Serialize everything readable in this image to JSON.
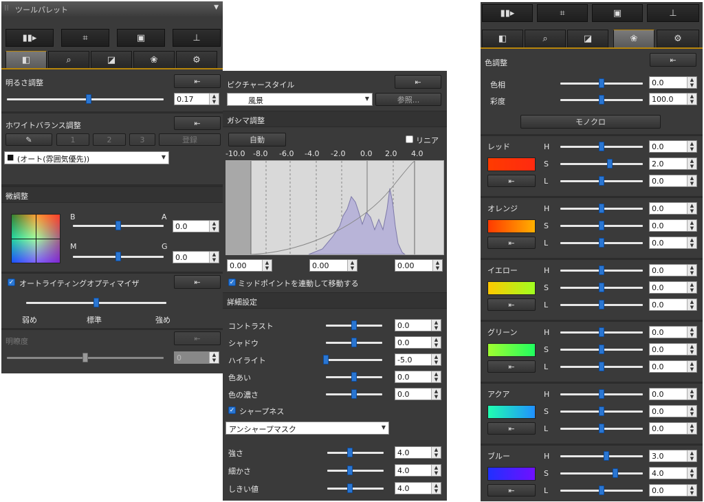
{
  "p1": {
    "title": "ツールパレット",
    "brightness": {
      "label": "明るさ調整",
      "value": "0.17",
      "level": 0.52
    },
    "wb": {
      "label": "ホワイトバランス調整",
      "btn1": "1",
      "btn2": "2",
      "btn3": "3",
      "register": "登録",
      "preset": "(オート(雰囲気優先))"
    },
    "fine": {
      "label": "微調整",
      "b": "B",
      "a": "A",
      "m": "M",
      "g": "G",
      "ba_value": "0.0",
      "mg_value": "0.0",
      "ba_level": 0.5,
      "mg_level": 0.5
    },
    "alo": {
      "label": "オートライティングオプティマイザ",
      "low": "弱め",
      "std": "標準",
      "high": "強め",
      "level": 0.5,
      "checked": true
    },
    "clarity": {
      "label": "明瞭度",
      "value": "0",
      "level": 0.5
    }
  },
  "p2": {
    "picture_style": {
      "label": "ピクチャースタイル",
      "value": "風景",
      "browse": "参照..."
    },
    "gamma": {
      "label": "ガンマ調整",
      "auto": "自動",
      "linear": "リニア",
      "ticks": [
        "-10.0",
        "-8.0",
        "-6.0",
        "-4.0",
        "-2.0",
        "0.0",
        "2.0",
        "4.0"
      ],
      "val1": "0.00",
      "val2": "0.00",
      "val3": "0.00",
      "midpoint": "ミッドポイントを連動して移動する"
    },
    "detail": {
      "label": "詳細設定",
      "rows": [
        {
          "label": "コントラスト",
          "value": "0.0",
          "level": 0.5
        },
        {
          "label": "シャドウ",
          "value": "0.0",
          "level": 0.5
        },
        {
          "label": "ハイライト",
          "value": "-5.0",
          "level": 0.0
        },
        {
          "label": "色あい",
          "value": "0.0",
          "level": 0.5
        },
        {
          "label": "色の濃さ",
          "value": "0.0",
          "level": 0.5
        }
      ]
    },
    "sharp": {
      "label": "シャープネス",
      "mode": "アンシャープマスク",
      "rows": [
        {
          "label": "強さ",
          "value": "4.0",
          "level": 0.4
        },
        {
          "label": "細かさ",
          "value": "4.0",
          "level": 0.4
        },
        {
          "label": "しきい値",
          "value": "4.0",
          "level": 0.4
        }
      ]
    }
  },
  "p3": {
    "label": "色調整",
    "hue": {
      "label": "色相",
      "value": "0.0",
      "level": 0.5
    },
    "sat": {
      "label": "彩度",
      "value": "100.0",
      "level": 0.5
    },
    "mono": "モノクロ",
    "colors": [
      {
        "name": "レッド",
        "h": "0.0",
        "s": "2.0",
        "l": "0.0",
        "hl": 0.5,
        "sl": 0.6,
        "ll": 0.5,
        "c1": "#ff3b00",
        "c2": "#ff2a10"
      },
      {
        "name": "オレンジ",
        "h": "0.0",
        "s": "0.0",
        "l": "0.0",
        "hl": 0.5,
        "sl": 0.5,
        "ll": 0.5,
        "c1": "#ff3a00",
        "c2": "#ffb000"
      },
      {
        "name": "イエロー",
        "h": "0.0",
        "s": "0.0",
        "l": "0.0",
        "hl": 0.5,
        "sl": 0.5,
        "ll": 0.5,
        "c1": "#ffc800",
        "c2": "#a0ff20"
      },
      {
        "name": "グリーン",
        "h": "0.0",
        "s": "0.0",
        "l": "0.0",
        "hl": 0.5,
        "sl": 0.5,
        "ll": 0.5,
        "c1": "#a0ff30",
        "c2": "#20ff60"
      },
      {
        "name": "アクア",
        "h": "0.0",
        "s": "0.0",
        "l": "0.0",
        "hl": 0.5,
        "sl": 0.5,
        "ll": 0.5,
        "c1": "#20ffb0",
        "c2": "#2090ff"
      },
      {
        "name": "ブルー",
        "h": "3.0",
        "s": "4.0",
        "l": "0.0",
        "hl": 0.56,
        "sl": 0.67,
        "ll": 0.5,
        "c1": "#2030ff",
        "c2": "#7010ff"
      }
    ],
    "h": "H",
    "s": "S",
    "l": "L"
  },
  "icons": [
    "compare-icon",
    "crop-icon",
    "image-icon",
    "stamp-icon",
    "brightness-tab-icon",
    "nr-tab-icon",
    "tone-tab-icon",
    "color-tab-icon",
    "settings-tab-icon",
    "reset-icon",
    "eyedropper-icon",
    "camera-icon",
    "double-chevron-icon"
  ]
}
